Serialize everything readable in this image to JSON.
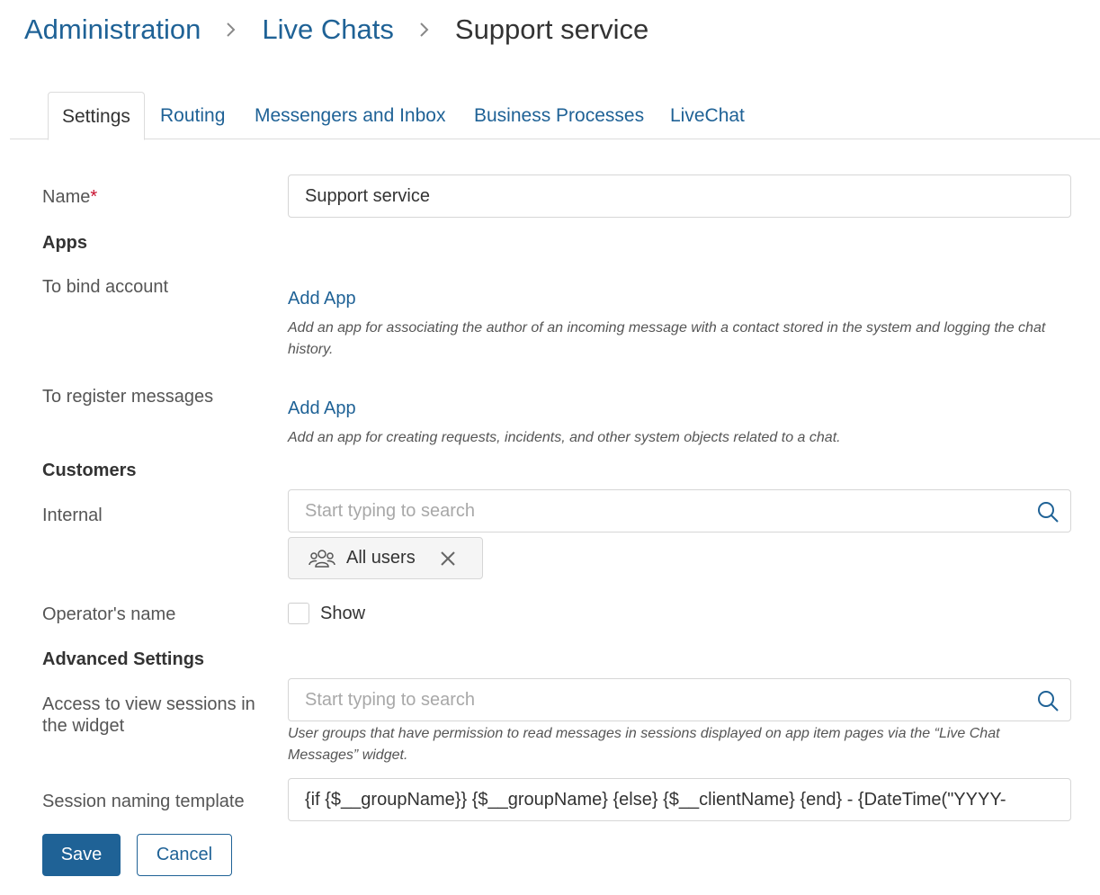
{
  "breadcrumb": {
    "items": [
      "Administration",
      "Live Chats"
    ],
    "current": "Support service"
  },
  "tabs": [
    "Settings",
    "Routing",
    "Messengers and Inbox",
    "Business Processes",
    "LiveChat"
  ],
  "active_tab": "Settings",
  "form": {
    "name_label": "Name",
    "required_mark": "*",
    "name_value": "Support service",
    "apps_section": "Apps",
    "bind_account_label": "To bind account",
    "add_app_label": "Add App",
    "bind_account_hint": "Add an app for associating the author of an incoming message with a contact stored in the system and logging the chat history.",
    "register_messages_label": "To register messages",
    "register_messages_hint": "Add an app for creating requests, incidents, and other system objects related to a chat.",
    "customers_section": "Customers",
    "internal_label": "Internal",
    "search_placeholder": "Start typing to search",
    "internal_chip": "All users",
    "operator_name_label": "Operator's name",
    "show_label": "Show",
    "advanced_section": "Advanced Settings",
    "access_label": "Access to view sessions in the widget",
    "access_hint": "User groups that have permission to read messages in sessions displayed on app item pages via the “Live Chat Messages” widget.",
    "session_template_label": "Session naming template",
    "session_template_value": "{if {$__groupName}} {$__groupName} {else} {$__clientName} {end} - {DateTime(\"YYYY-"
  },
  "buttons": {
    "save": "Save",
    "cancel": "Cancel"
  },
  "colors": {
    "link": "#1f6296",
    "primary_button": "#1f6296",
    "required": "#c8102e"
  }
}
